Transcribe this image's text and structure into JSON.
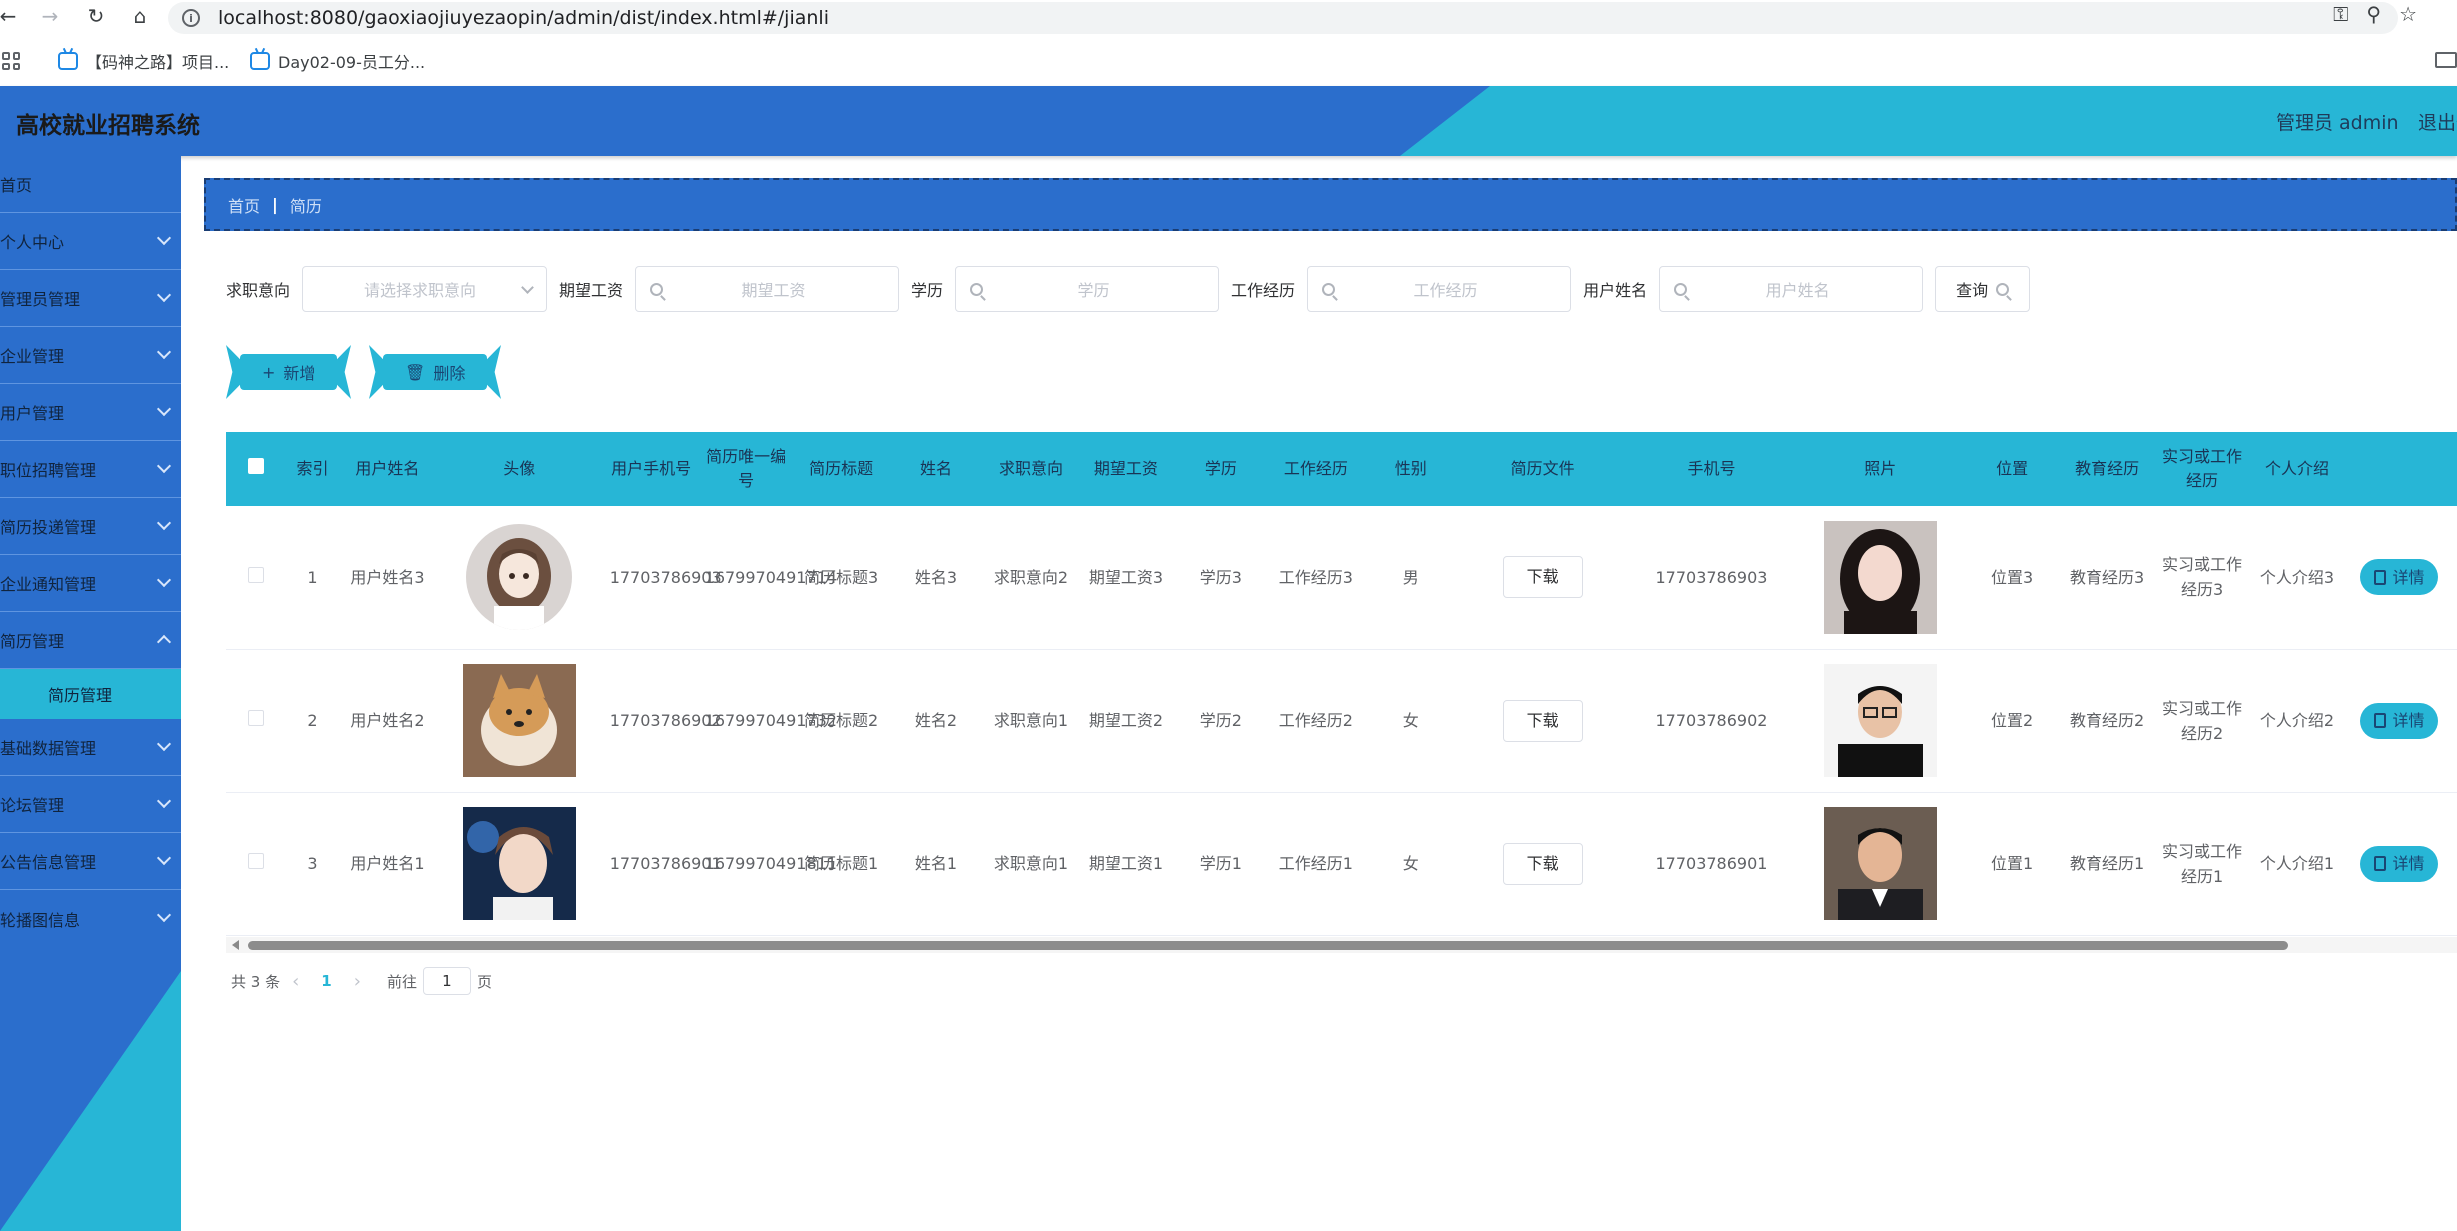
{
  "browser": {
    "url": "localhost:8080/gaoxiaojiuyezaopin/admin/dist/index.html#/jianli",
    "bookmarks": [
      "【码神之路】项目...",
      "Day02-09-员工分..."
    ]
  },
  "header": {
    "title": "高校就业招聘系统",
    "admin_label": "管理员 admin",
    "logout": "退出登录"
  },
  "sidebar": {
    "items": [
      {
        "label": "首页",
        "has_children": false
      },
      {
        "label": "个人中心",
        "has_children": true
      },
      {
        "label": "管理员管理",
        "has_children": true
      },
      {
        "label": "企业管理",
        "has_children": true
      },
      {
        "label": "用户管理",
        "has_children": true
      },
      {
        "label": "职位招聘管理",
        "has_children": true
      },
      {
        "label": "简历投递管理",
        "has_children": true
      },
      {
        "label": "企业通知管理",
        "has_children": true
      },
      {
        "label": "简历管理",
        "has_children": true
      }
    ],
    "active_sub": "简历管理",
    "items_after": [
      {
        "label": "基础数据管理"
      },
      {
        "label": "论坛管理"
      },
      {
        "label": "公告信息管理"
      },
      {
        "label": "轮播图信息"
      }
    ]
  },
  "breadcrumb": {
    "home": "首页",
    "current": "简历"
  },
  "search": {
    "intent_label": "求职意向",
    "intent_placeholder": "请选择求职意向",
    "salary_label": "期望工资",
    "salary_placeholder": "期望工资",
    "edu_label": "学历",
    "edu_placeholder": "学历",
    "exp_label": "工作经历",
    "exp_placeholder": "工作经历",
    "name_label": "用户姓名",
    "name_placeholder": "用户姓名",
    "query_label": "查询"
  },
  "actions": {
    "add": "新增",
    "delete": "删除"
  },
  "table": {
    "headers": [
      "索引",
      "用户姓名",
      "头像",
      "用户手机号",
      "简历唯一编号",
      "简历标题",
      "姓名",
      "求职意向",
      "期望工资",
      "学历",
      "工作经历",
      "性别",
      "简历文件",
      "手机号",
      "照片",
      "位置",
      "教育经历",
      "实习或工作经历",
      "个人介绍"
    ],
    "download_label": "下载",
    "detail_label": "详情",
    "rows": [
      {
        "index": "1",
        "username": "用户姓名3",
        "phone": "17703786903",
        "resume_no": "1679970491714",
        "title": "简历标题3",
        "name": "姓名3",
        "intent": "求职意向2",
        "salary": "期望工资3",
        "edu": "学历3",
        "exp": "工作经历3",
        "gender": "男",
        "mobile": "17703786903",
        "location": "位置3",
        "education": "教育经历3",
        "internship": "实习或工作经历3",
        "intro": "个人介绍3"
      },
      {
        "index": "2",
        "username": "用户姓名2",
        "phone": "17703786902",
        "resume_no": "1679970491732",
        "title": "简历标题2",
        "name": "姓名2",
        "intent": "求职意向1",
        "salary": "期望工资2",
        "edu": "学历2",
        "exp": "工作经历2",
        "gender": "女",
        "mobile": "17703786902",
        "location": "位置2",
        "education": "教育经历2",
        "internship": "实习或工作经历2",
        "intro": "个人介绍2"
      },
      {
        "index": "3",
        "username": "用户姓名1",
        "phone": "17703786901",
        "resume_no": "1679970491811",
        "title": "简历标题1",
        "name": "姓名1",
        "intent": "求职意向1",
        "salary": "期望工资1",
        "edu": "学历1",
        "exp": "工作经历1",
        "gender": "女",
        "mobile": "17703786901",
        "location": "位置1",
        "education": "教育经历1",
        "internship": "实习或工作经历1",
        "intro": "个人介绍1"
      }
    ]
  },
  "pagination": {
    "total": "共 3 条",
    "current_page": "1",
    "goto": "前往",
    "page_input": "1",
    "page_suffix": "页"
  },
  "colors": {
    "primary": "#2b6ecc",
    "accent": "#27b6d6"
  }
}
